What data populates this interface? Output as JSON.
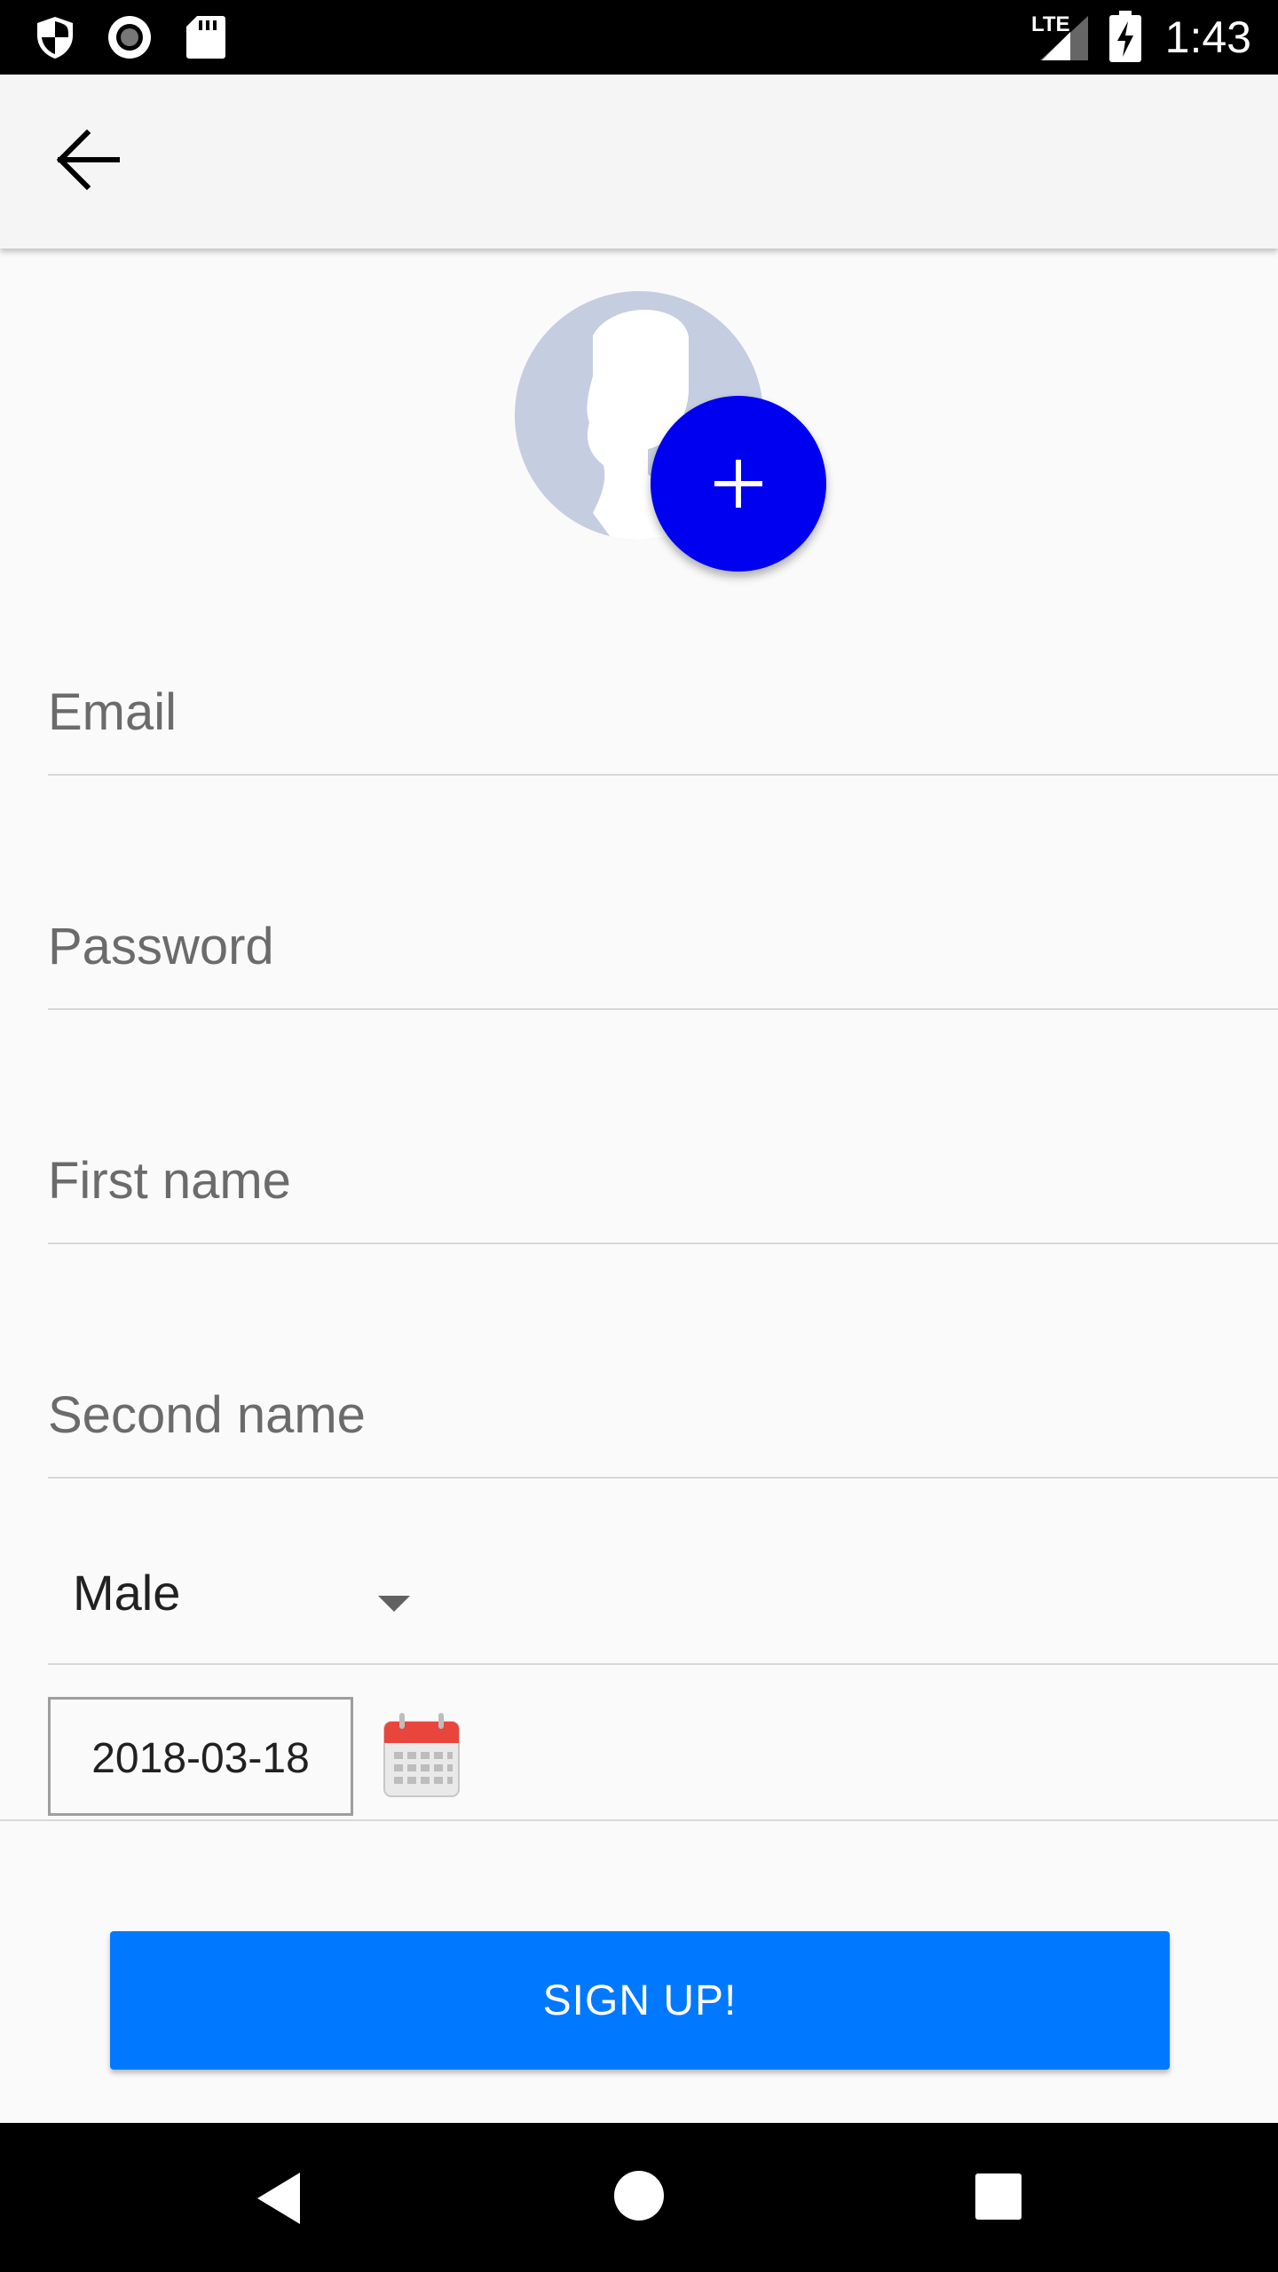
{
  "status_bar": {
    "time": "1:43",
    "network": "LTE",
    "icons": [
      "shield-icon",
      "record-icon",
      "sd-card-icon",
      "signal-icon",
      "battery-charging-icon"
    ]
  },
  "toolbar": {
    "back_icon": "arrow-back-icon"
  },
  "avatar": {
    "add_icon": "plus-icon"
  },
  "form": {
    "email_placeholder": "Email",
    "password_placeholder": "Password",
    "first_name_placeholder": "First name",
    "second_name_placeholder": "Second name",
    "gender": "Male",
    "date": "2018-03-18"
  },
  "signup_label": "SIGN UP!",
  "colors": {
    "fab": "#0000f0",
    "primary_button": "#0078ff",
    "avatar_bg": "#c5cde0"
  },
  "nav_bar": {
    "icons": [
      "back-triangle-icon",
      "home-circle-icon",
      "recents-square-icon"
    ]
  }
}
